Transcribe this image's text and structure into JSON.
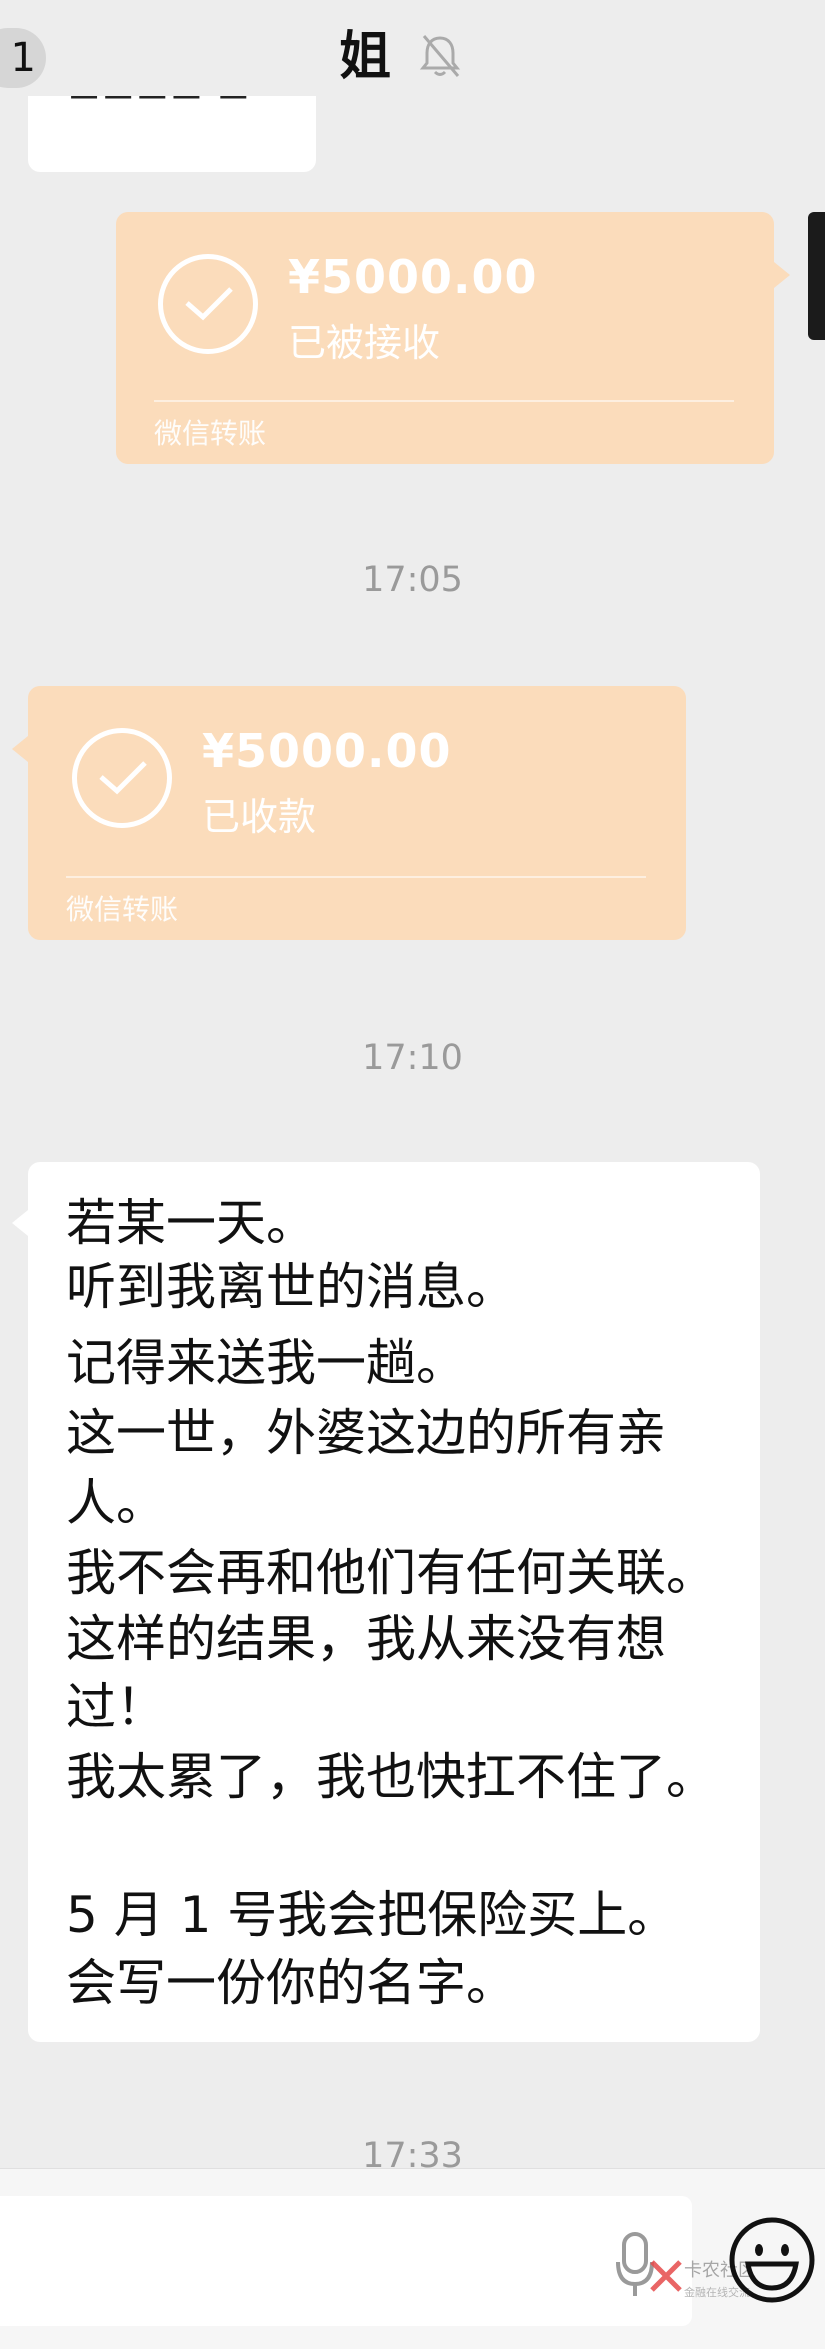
{
  "header": {
    "back_count": "1",
    "title": "姐",
    "mute_icon": "bell-muted-icon"
  },
  "transfers": [
    {
      "direction": "sent",
      "amount": "¥5000.00",
      "status": "已被接收",
      "footer": "微信转账",
      "icon": "check-circle-icon",
      "color": "#fbdcbb"
    },
    {
      "direction": "received",
      "amount": "¥5000.00",
      "status": "已收款",
      "footer": "微信转账",
      "icon": "check-circle-icon",
      "color": "#fbdcbb"
    }
  ],
  "timestamps": [
    "17:05",
    "17:10",
    "17:33"
  ],
  "message": {
    "lines": [
      "若某一天。",
      "听到我离世的消息。",
      "记得来送我一趟。",
      "这一世，外婆这边的所有亲",
      "人。",
      "我不会再和他们有任何关联。",
      "这样的结果，我从来没有想",
      "过！",
      "我太累了，我也快扛不住了。",
      "",
      "5 月 1 号我会把保险买上。",
      "会写一份你的名字。"
    ]
  },
  "input_bar": {
    "voice_icon": "microphone-icon",
    "emoji_icon": "smiley-icon",
    "watermark_text": "卡农社区",
    "watermark_sub": "金融在线交流"
  }
}
